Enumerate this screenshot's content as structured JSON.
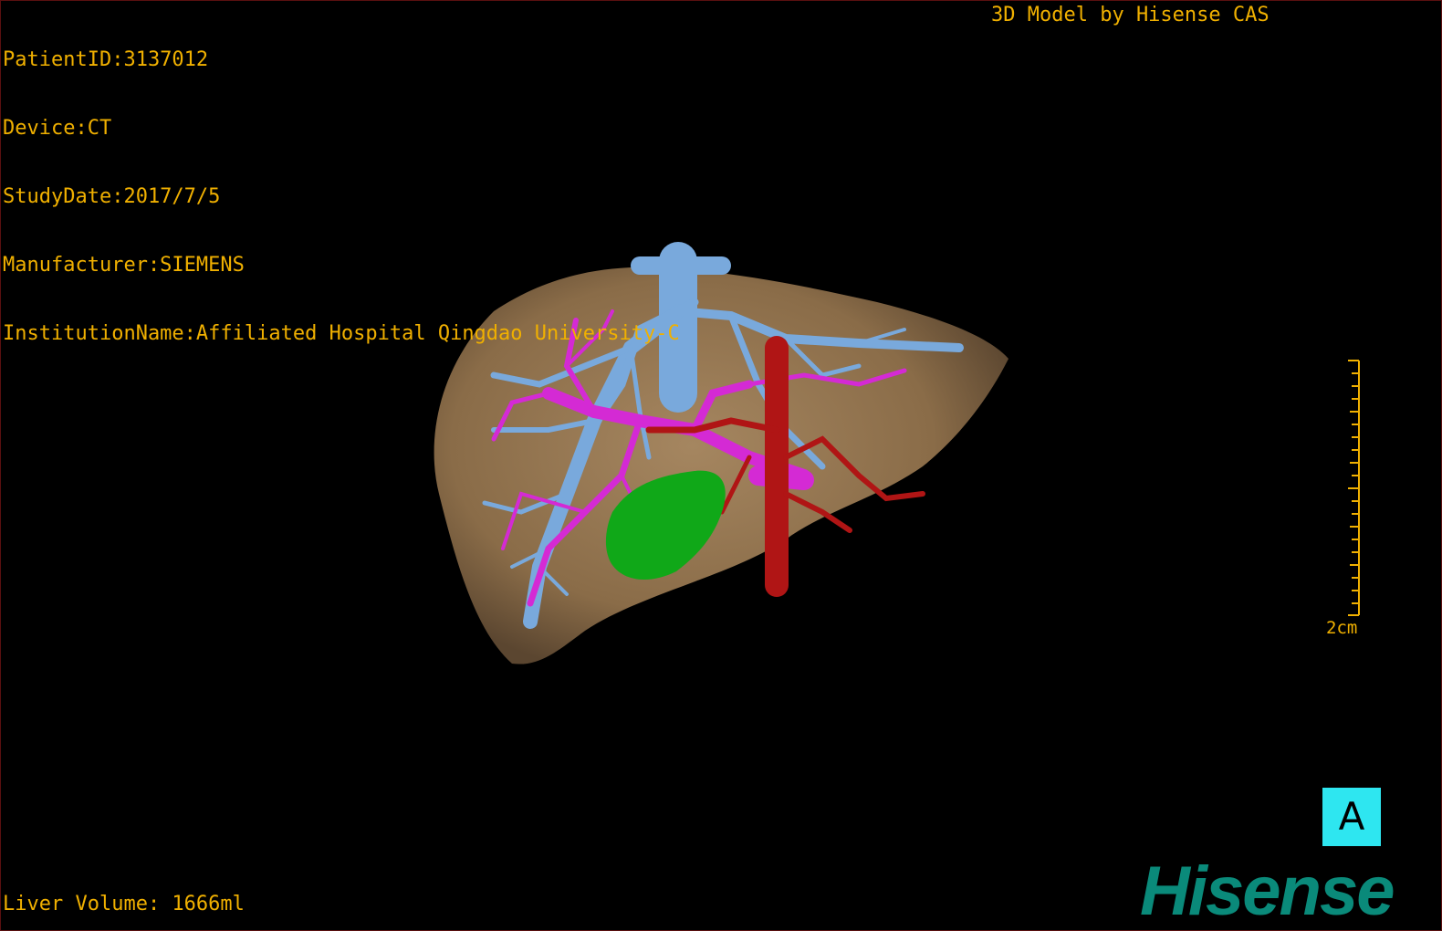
{
  "patient_info": {
    "patient_id": "PatientID:3137012",
    "device": "Device:CT",
    "study_date": "StudyDate:2017/7/5",
    "manufacturer": "Manufacturer:SIEMENS",
    "institution": "InstitutionName:Affiliated Hospital Qingdao University-C"
  },
  "credit": "3D Model by Hisense CAS",
  "liver_volume": "Liver Volume: 1666ml",
  "scale_bar": {
    "label": "2cm"
  },
  "orientation_marker": {
    "label": "A",
    "color": "#2ee6f0"
  },
  "logo": {
    "text": "Hisense",
    "color": "#0a8a7a"
  },
  "colors": {
    "overlay_text": "#f0b000",
    "liver": "#8a6c48",
    "hepatic_vein": "#79a9dc",
    "portal_vein": "#d42ad4",
    "artery": "#b01515",
    "lesion": "#10a818"
  }
}
